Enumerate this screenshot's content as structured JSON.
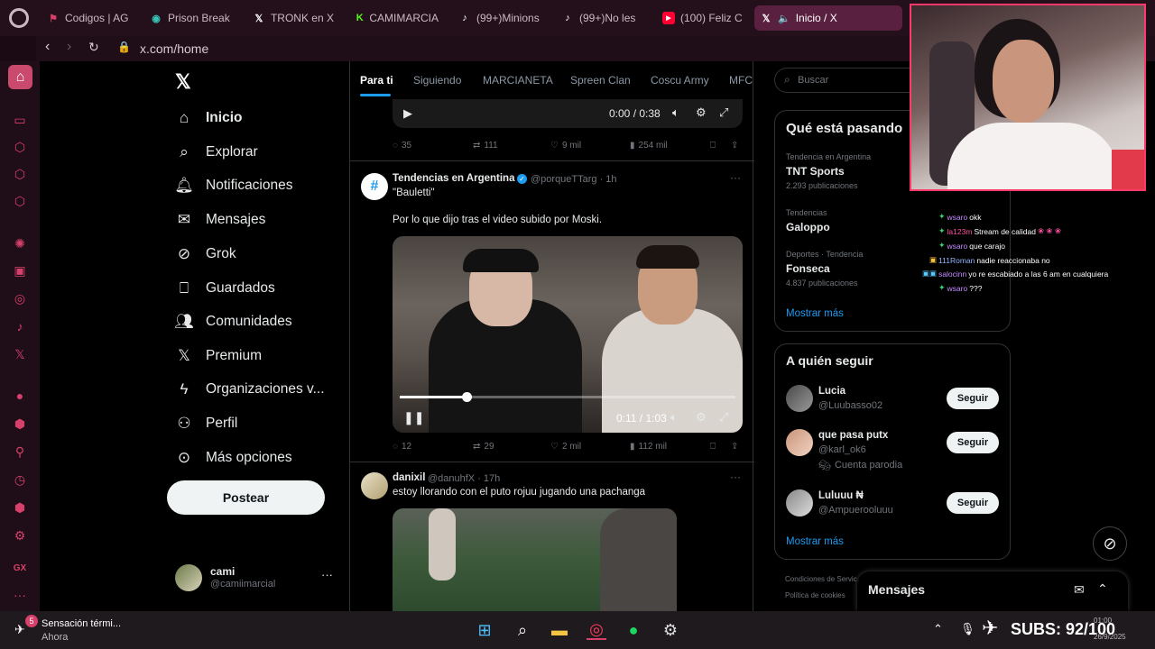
{
  "browser": {
    "tabs": [
      {
        "label": "Codigos | AG",
        "icon": "opera-gx-icon",
        "color": "#d6406a"
      },
      {
        "label": "Prison Break",
        "icon": "site-icon",
        "color": "#35c3b5"
      },
      {
        "label": "TRONK en X",
        "icon": "x-icon",
        "color": "#ffffff"
      },
      {
        "label": "CAMIMARCIA",
        "icon": "kick-icon",
        "color": "#53fc18"
      },
      {
        "label": "(99+)Minions",
        "icon": "tiktok-icon",
        "color": "#ffffff"
      },
      {
        "label": "(99+)No les",
        "icon": "tiktok-icon",
        "color": "#ffffff"
      },
      {
        "label": "(100) Feliz C",
        "icon": "youtube-icon",
        "color": "#ff0033"
      },
      {
        "label": "Inicio / X",
        "icon": "x-icon",
        "color": "#ffffff"
      }
    ],
    "url": "x.com/home"
  },
  "nav": {
    "items": [
      {
        "label": "Inicio",
        "icon": "home-icon"
      },
      {
        "label": "Explorar",
        "icon": "search-icon"
      },
      {
        "label": "Notificaciones",
        "icon": "bell-icon"
      },
      {
        "label": "Mensajes",
        "icon": "mail-icon"
      },
      {
        "label": "Grok",
        "icon": "grok-icon"
      },
      {
        "label": "Guardados",
        "icon": "bookmark-icon"
      },
      {
        "label": "Comunidades",
        "icon": "people-icon"
      },
      {
        "label": "Premium",
        "icon": "x-icon"
      },
      {
        "label": "Organizaciones v...",
        "icon": "lightning-icon"
      },
      {
        "label": "Perfil",
        "icon": "person-icon"
      },
      {
        "label": "Más opciones",
        "icon": "more-circle-icon"
      }
    ],
    "post_label": "Postear",
    "account": {
      "name": "cami",
      "handle": "@camiimarcial"
    }
  },
  "feed": {
    "tabs": [
      "Para ti",
      "Siguiendo",
      "MARCIANETA",
      "Spreen Clan",
      "Coscu Army",
      "MFC"
    ],
    "top_video": {
      "time": "0:00 / 0:38"
    },
    "top_stats": {
      "replies": "35",
      "reposts": "111",
      "likes": "9 mil",
      "views": "254 mil"
    },
    "post1": {
      "author": "Tendencias en Argentina",
      "handle": "@porqueTTarg · 1h",
      "quote": "\"Bauletti\"",
      "text": "Por lo que dijo tras el video subido por Moski.",
      "video_time": "0:11 / 1:03",
      "progress": 0.2,
      "stats": {
        "replies": "12",
        "reposts": "29",
        "likes": "2 mil",
        "views": "112 mil"
      }
    },
    "post2": {
      "author": "danixil",
      "handle": "@danuhfX · 17h",
      "text": "estoy llorando con el puto rojuu jugando una pachanga"
    }
  },
  "sidebar": {
    "search_placeholder": "Buscar",
    "trends_title": "Qué está pasando",
    "trends": [
      {
        "category": "Tendencia en Argentina",
        "name": "TNT Sports",
        "count": "2.293 publicaciones"
      },
      {
        "category": "Tendencias",
        "name": "Galoppo",
        "count": ""
      },
      {
        "category": "Deportes · Tendencia",
        "name": "Fonseca",
        "count": "4.837 publicaciones"
      }
    ],
    "show_more": "Mostrar más",
    "follow_title": "A quién seguir",
    "follow": [
      {
        "name": "Lucia",
        "handle": "@Luubasso02",
        "extra": ""
      },
      {
        "name": "que pasa putx",
        "handle": "@karl_ok6",
        "extra": "Cuenta parodia"
      },
      {
        "name": "Luluuu ₦",
        "handle": "@Ampuerooluuu",
        "extra": ""
      }
    ],
    "follow_label": "Seguir",
    "show_more2": "Mostrar más",
    "footer1": "Condiciones de Servicio",
    "footer2": "Política de cookies",
    "messages_title": "Mensajes"
  },
  "chat": {
    "lines": [
      {
        "user": "wsaro",
        "text": "okk",
        "color": "#c58cff"
      },
      {
        "user": "la123m",
        "text": "Stream de calidad",
        "color": "#ff4fa0"
      },
      {
        "user": "wsaro",
        "text": "que carajo",
        "color": "#c58cff"
      },
      {
        "user": "111Roman",
        "text": "nadie reaccionaba no",
        "color": "#8fb4ff"
      },
      {
        "user": "salocinn",
        "text": "yo re escabiado a las 6 am en cualquiera",
        "color": "#c58cff"
      },
      {
        "user": "wsaro",
        "text": "???",
        "color": "#c58cff"
      }
    ]
  },
  "taskbar": {
    "notif_title": "Sensación térmi...",
    "notif_sub": "Ahora",
    "notif_badge": "5",
    "subs": "SUBS: 92/100",
    "clock_time": "01:00",
    "clock_date": "26/9/2025"
  },
  "colors": {
    "x_blue": "#1d9bf0",
    "opera_accent": "#d6406a",
    "cam_border": "#ff3a6a"
  }
}
